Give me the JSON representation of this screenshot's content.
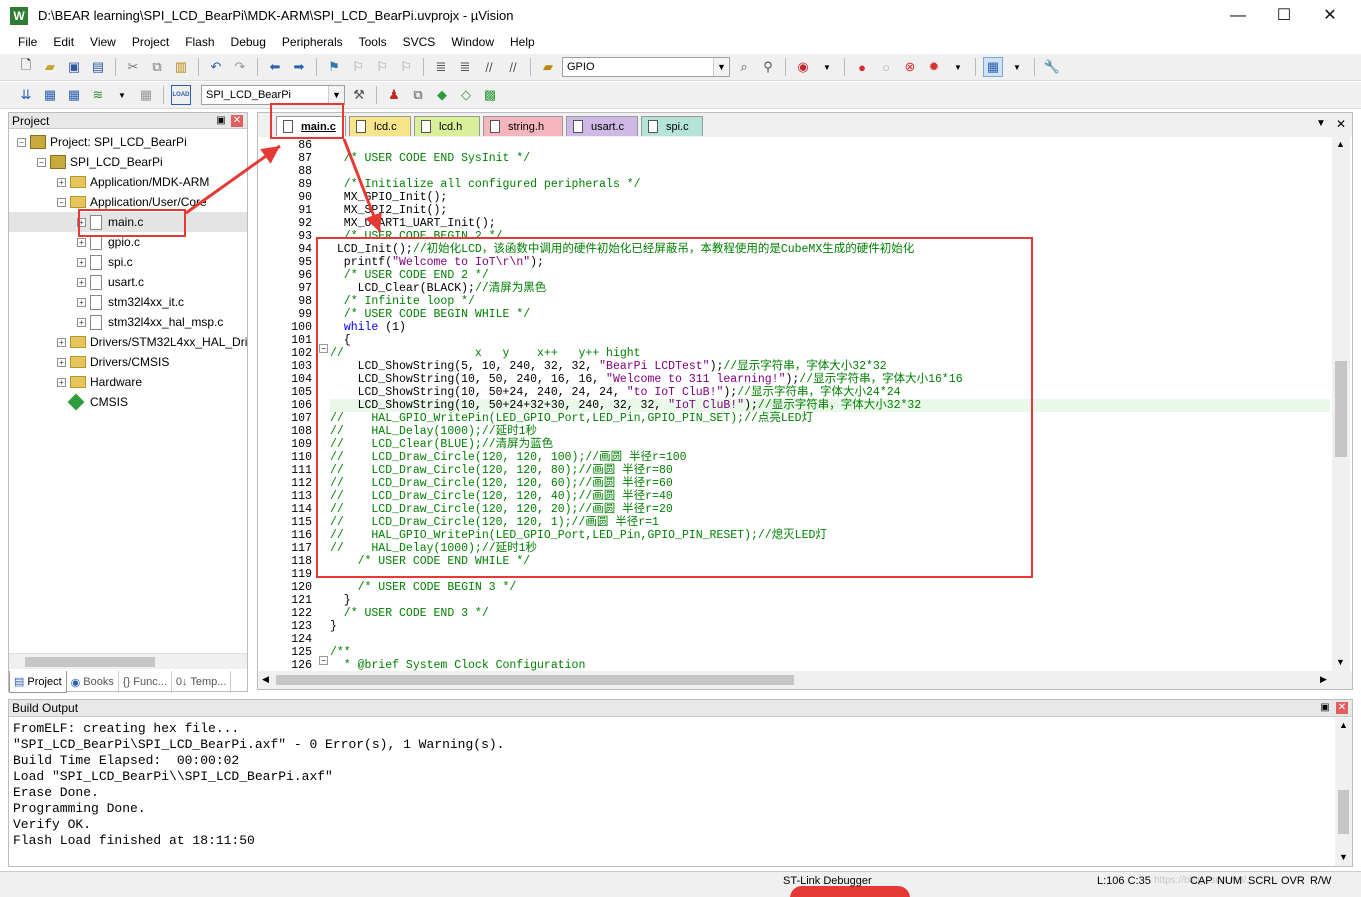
{
  "window": {
    "title": "D:\\BEAR learning\\SPI_LCD_BearPi\\MDK-ARM\\SPI_LCD_BearPi.uvprojx - µVision",
    "app_icon": "W",
    "controls": [
      "—",
      "☐",
      "✕"
    ]
  },
  "menu": [
    "File",
    "Edit",
    "View",
    "Project",
    "Flash",
    "Debug",
    "Peripherals",
    "Tools",
    "SVCS",
    "Window",
    "Help"
  ],
  "toolbar": {
    "find_combo": "GPIO",
    "target_combo": "SPI_LCD_BearPi",
    "load_label": "LOAD"
  },
  "project_panel": {
    "title": "Project",
    "pin": "▣",
    "close": "✕",
    "tree": [
      {
        "label": "Project: SPI_LCD_BearPi",
        "expander": "−"
      },
      {
        "label": "SPI_LCD_BearPi",
        "expander": "−"
      },
      {
        "label": "Application/MDK-ARM",
        "expander": "+"
      },
      {
        "label": "Application/User/Core",
        "expander": "−"
      },
      {
        "label": "main.c",
        "expander": "+"
      },
      {
        "label": "gpio.c",
        "expander": "+"
      },
      {
        "label": "spi.c",
        "expander": "+"
      },
      {
        "label": "usart.c",
        "expander": "+"
      },
      {
        "label": "stm32l4xx_it.c",
        "expander": "+"
      },
      {
        "label": "stm32l4xx_hal_msp.c",
        "expander": "+"
      },
      {
        "label": "Drivers/STM32L4xx_HAL_Driv",
        "expander": "+"
      },
      {
        "label": "Drivers/CMSIS",
        "expander": "+"
      },
      {
        "label": "Hardware",
        "expander": "+"
      },
      {
        "label": "CMSIS",
        "expander": ""
      }
    ],
    "tabs": [
      "Project",
      "Books",
      "{} Func...",
      "0↓ Temp..."
    ]
  },
  "editor": {
    "tabs": [
      {
        "label": "main.c",
        "color": "#ffffff"
      },
      {
        "label": "lcd.c",
        "color": "#f6e58a"
      },
      {
        "label": "lcd.h",
        "color": "#d9ef9a"
      },
      {
        "label": "string.h",
        "color": "#f5b5bd"
      },
      {
        "label": "usart.c",
        "color": "#cdb8e6"
      },
      {
        "label": "spi.c",
        "color": "#b6e3d8"
      }
    ],
    "tab_menu": "▼",
    "tab_close": "✕",
    "lines": [
      {
        "n": "86",
        "t": ""
      },
      {
        "n": "87",
        "t": "  /* USER CODE END SysInit */"
      },
      {
        "n": "88",
        "t": ""
      },
      {
        "n": "89",
        "t": "  /* Initialize all configured peripherals */"
      },
      {
        "n": "90",
        "t": "  MX_GPIO_Init();"
      },
      {
        "n": "91",
        "t": "  MX_SPI2_Init();"
      },
      {
        "n": "92",
        "t": "  MX_USART1_UART_Init();"
      },
      {
        "n": "93",
        "t": "  /* USER CODE BEGIN 2 */"
      },
      {
        "n": "94",
        "t": " LCD_Init();//初始化LCD，该函数中调用的硬件初始化已经屏蔽吊，本教程使用的是CubeMX生成的硬件初始化"
      },
      {
        "n": "95",
        "t": "  printf(\"Welcome to IoT\\r\\n\");"
      },
      {
        "n": "96",
        "t": "  /* USER CODE END 2 */"
      },
      {
        "n": "97",
        "t": "    LCD_Clear(BLACK);//清屏为黑色"
      },
      {
        "n": "98",
        "t": "  /* Infinite loop */"
      },
      {
        "n": "99",
        "t": "  /* USER CODE BEGIN WHILE */"
      },
      {
        "n": "100",
        "t": "  while (1)"
      },
      {
        "n": "101",
        "t": "  {"
      },
      {
        "n": "102",
        "t": "//                   x   y    x++   y++ hight"
      },
      {
        "n": "103",
        "t": "    LCD_ShowString(5, 10, 240, 32, 32, \"BearPi LCDTest\");//显示字符串，字体大小32*32"
      },
      {
        "n": "104",
        "t": "    LCD_ShowString(10, 50, 240, 16, 16, \"Welcome to 311 learning!\");//显示字符串，字体大小16*16"
      },
      {
        "n": "105",
        "t": "    LCD_ShowString(10, 50+24, 240, 24, 24, \"to IoT CluB!\");//显示字符串，字体大小24*24"
      },
      {
        "n": "106",
        "t": "    LCD_ShowString(10, 50+24+32+30, 240, 32, 32, \"IoT CluB!\");//显示字符串，字体大小32*32"
      },
      {
        "n": "107",
        "t": "//    HAL_GPIO_WritePin(LED_GPIO_Port,LED_Pin,GPIO_PIN_SET);//点亮LED灯"
      },
      {
        "n": "108",
        "t": "//    HAL_Delay(1000);//延时1秒"
      },
      {
        "n": "109",
        "t": "//    LCD_Clear(BLUE);//清屏为蓝色"
      },
      {
        "n": "110",
        "t": "//    LCD_Draw_Circle(120, 120, 100);//画圆 半径r=100"
      },
      {
        "n": "111",
        "t": "//    LCD_Draw_Circle(120, 120, 80);//画圆 半径r=80"
      },
      {
        "n": "112",
        "t": "//    LCD_Draw_Circle(120, 120, 60);//画圆 半径r=60"
      },
      {
        "n": "113",
        "t": "//    LCD_Draw_Circle(120, 120, 40);//画圆 半径r=40"
      },
      {
        "n": "114",
        "t": "//    LCD_Draw_Circle(120, 120, 20);//画圆 半径r=20"
      },
      {
        "n": "115",
        "t": "//    LCD_Draw_Circle(120, 120, 1);//画圆 半径r=1"
      },
      {
        "n": "116",
        "t": "//    HAL_GPIO_WritePin(LED_GPIO_Port,LED_Pin,GPIO_PIN_RESET);//熄灭LED灯"
      },
      {
        "n": "117",
        "t": "//    HAL_Delay(1000);//延时1秒"
      },
      {
        "n": "118",
        "t": "    /* USER CODE END WHILE */"
      },
      {
        "n": "119",
        "t": ""
      },
      {
        "n": "120",
        "t": "    /* USER CODE BEGIN 3 */"
      },
      {
        "n": "121",
        "t": "  }"
      },
      {
        "n": "122",
        "t": "  /* USER CODE END 3 */"
      },
      {
        "n": "123",
        "t": "}"
      },
      {
        "n": "124",
        "t": ""
      },
      {
        "n": "125",
        "t": "/**"
      },
      {
        "n": "126",
        "t": "  * @brief System Clock Configuration"
      }
    ]
  },
  "build_output": {
    "title": "Build Output",
    "lines": [
      "FromELF: creating hex file...",
      "\"SPI_LCD_BearPi\\SPI_LCD_BearPi.axf\" - 0 Error(s), 1 Warning(s).",
      "Build Time Elapsed:  00:00:02",
      "Load \"SPI_LCD_BearPi\\\\SPI_LCD_BearPi.axf\"",
      "Erase Done.",
      "Programming Done.",
      "Verify OK.",
      "Flash Load finished at 18:11:50"
    ]
  },
  "status": {
    "debugger": "ST-Link Debugger",
    "position": "L:106 C:35",
    "cap": "CAP",
    "num": "NUM",
    "scrl": "SCRL",
    "ovr": "OVR",
    "rw": "R/W",
    "watermark": "https://blog.csdn.net/..."
  },
  "colors": {
    "annotation": "#e53935",
    "comment": "#008000",
    "keyword": "#0000ff",
    "string": "#800080",
    "current_line": "#e9f8e9"
  }
}
